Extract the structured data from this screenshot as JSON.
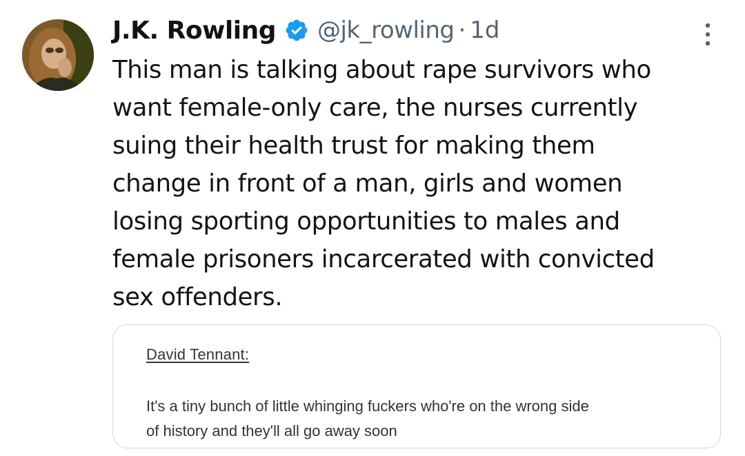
{
  "author": {
    "name": "J.K. Rowling",
    "handle": "@jk_rowling",
    "separator": "·",
    "time": "1d",
    "verified": true,
    "verified_color": "#1d9bf0"
  },
  "tweet": {
    "lines": [
      "This man is talking about rape survivors who",
      "want female-only care, the nurses currently",
      "suing their health trust for making them",
      "change in front of a man, girls and women",
      "losing sporting opportunities to males and",
      "female prisoners incarcerated with convicted",
      "sex offenders."
    ]
  },
  "quote": {
    "author": "David Tennant:",
    "lines": [
      "It's a tiny bunch of little whinging fuckers who're on the wrong side",
      "of history and they'll all go away soon"
    ]
  },
  "icons": {
    "verified": "verified-badge-icon",
    "more": "more-options-icon"
  },
  "colors": {
    "text": "#0f1419",
    "secondary": "#536471",
    "border": "#cfd9de"
  }
}
